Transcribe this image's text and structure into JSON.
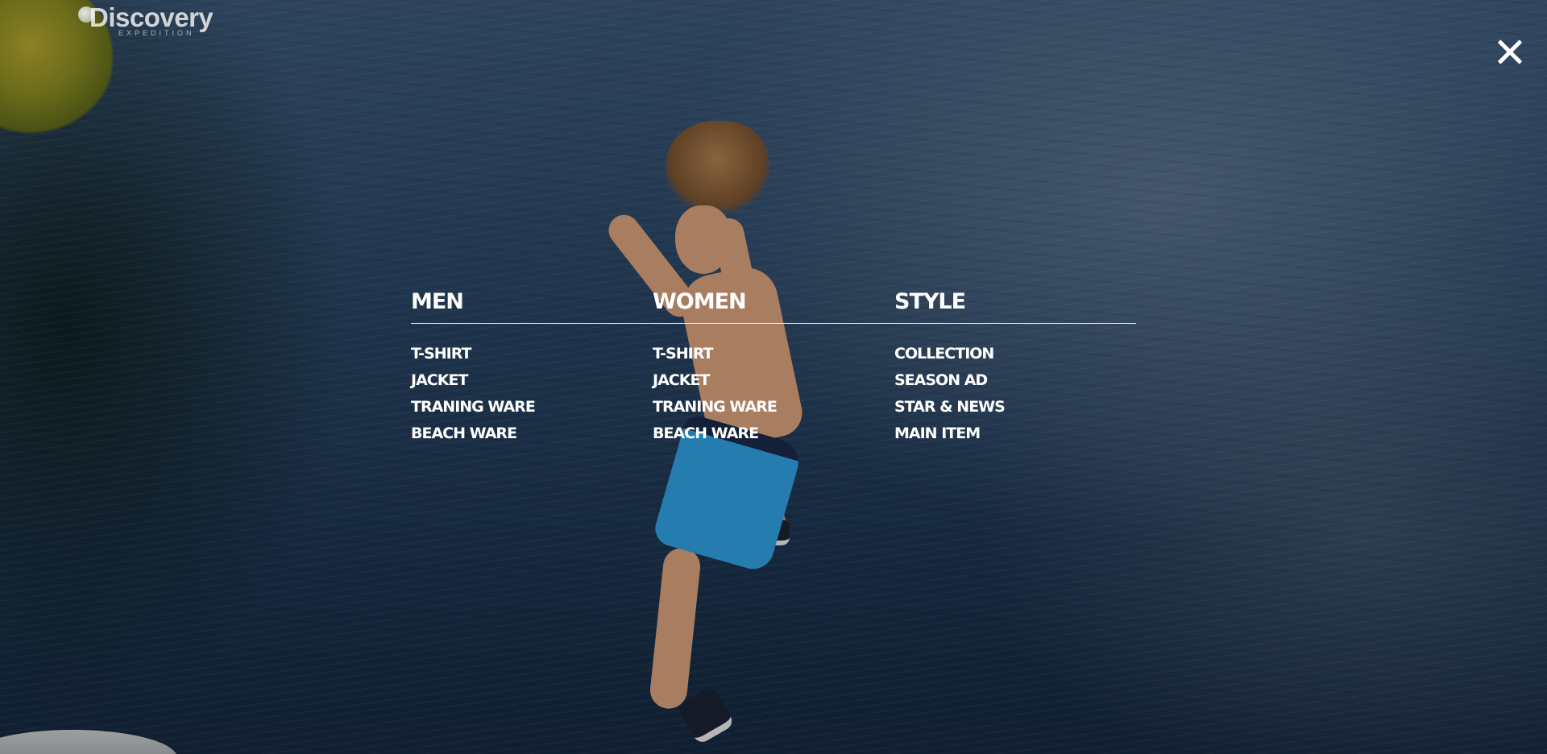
{
  "brand": {
    "name": "Discovery",
    "subtitle": "EXPEDITION"
  },
  "close": {
    "icon": "close-icon"
  },
  "menu": {
    "columns": [
      {
        "heading": "MEN",
        "items": [
          "T-SHIRT",
          "JACKET",
          "TRANING WARE",
          "BEACH WARE"
        ]
      },
      {
        "heading": "WOMEN",
        "items": [
          "T-SHIRT",
          "JACKET",
          "TRANING WARE",
          "BEACH WARE"
        ]
      },
      {
        "heading": "STYLE",
        "items": [
          "COLLECTION",
          "SEASON AD",
          "STAR & NEWS",
          "MAIN ITEM"
        ]
      }
    ]
  },
  "colors": {
    "text": "#ffffff",
    "water": "#2b4766",
    "shorts": "#2f9fe0"
  }
}
